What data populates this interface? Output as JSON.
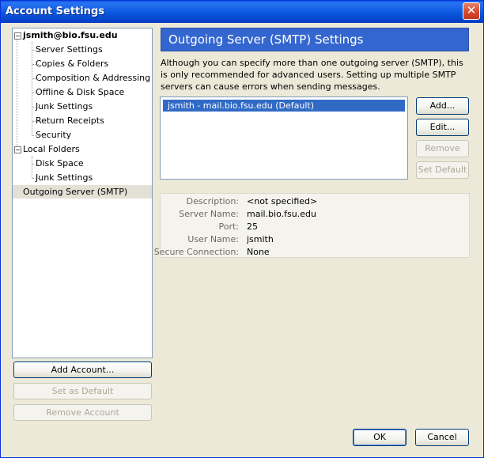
{
  "window": {
    "title": "Account Settings",
    "close_glyph": "✕"
  },
  "tree": {
    "account": "jsmith@bio.fsu.edu",
    "account_items": [
      "Server Settings",
      "Copies & Folders",
      "Composition & Addressing",
      "Offline & Disk Space",
      "Junk Settings",
      "Return Receipts",
      "Security"
    ],
    "local": "Local Folders",
    "local_items": [
      "Disk Space",
      "Junk Settings"
    ],
    "smtp": "Outgoing Server (SMTP)"
  },
  "left_buttons": {
    "add_account": "Add Account...",
    "set_default": "Set as Default",
    "remove_account": "Remove Account"
  },
  "panel": {
    "title": "Outgoing Server (SMTP) Settings",
    "description": "Although you can specify more than one outgoing server (SMTP), this is only recommended for advanced users. Setting up multiple SMTP servers can cause errors when sending messages.",
    "servers": [
      "jsmith - mail.bio.fsu.edu (Default)"
    ],
    "buttons": {
      "add": "Add...",
      "edit": "Edit...",
      "remove": "Remove",
      "set_default": "Set Default"
    },
    "details": {
      "description_label": "Description:",
      "description_value": "<not specified>",
      "server_label": "Server Name:",
      "server_value": "mail.bio.fsu.edu",
      "port_label": "Port:",
      "port_value": "25",
      "user_label": "User Name:",
      "user_value": "jsmith",
      "secure_label": "Secure Connection:",
      "secure_value": "None"
    }
  },
  "footer": {
    "ok": "OK",
    "cancel": "Cancel"
  }
}
